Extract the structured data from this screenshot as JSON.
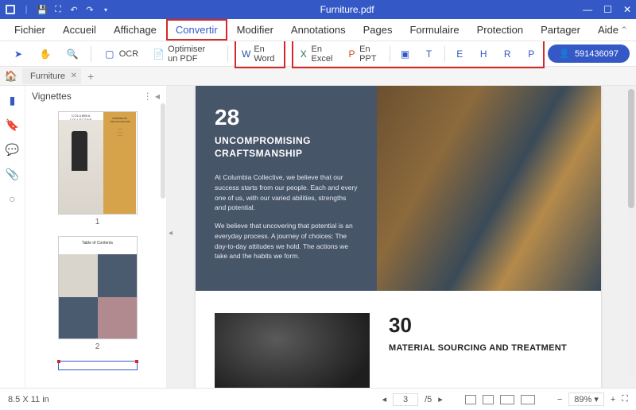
{
  "titlebar": {
    "filename": "Furniture.pdf"
  },
  "menu": {
    "items": [
      "Fichier",
      "Accueil",
      "Affichage",
      "Convertir",
      "Modifier",
      "Annotations",
      "Pages",
      "Formulaire",
      "Protection",
      "Partager",
      "Aide"
    ],
    "active_index": 3
  },
  "toolbar": {
    "ocr": "OCR",
    "optimize": "Optimiser un PDF",
    "en_word": "En Word",
    "en_excel": "En Excel",
    "en_ppt": "En PPT"
  },
  "account": {
    "id": "591436097"
  },
  "tabs": {
    "tab1": "Furniture"
  },
  "sidepanel": {
    "title": "Vignettes",
    "page1_num": "1",
    "page2_num": "2"
  },
  "thumb1": {
    "brand": "COLUMBIA",
    "sub": "COLLECTIVE"
  },
  "thumb2": {
    "toc": "Table of Contents"
  },
  "doc": {
    "p28_num": "28",
    "p28_head": "UNCOMPROMISING CRAFTSMANSHIP",
    "p28_para1": "At Columbia Collective, we believe that our success starts from our people. Each and every one of us, with our varied abilities, strengths and potential.",
    "p28_para2": "We believe that uncovering that potential is an everyday process. A journey of choices: The day-to-day attitudes we hold. The actions we take and the habits we form.",
    "p30_num": "30",
    "p30_head": "MATERIAL SOURCING AND TREATMENT"
  },
  "status": {
    "dims": "8.5 X 11 in",
    "page_current": "3",
    "page_total": "/5",
    "zoom": "89%"
  }
}
